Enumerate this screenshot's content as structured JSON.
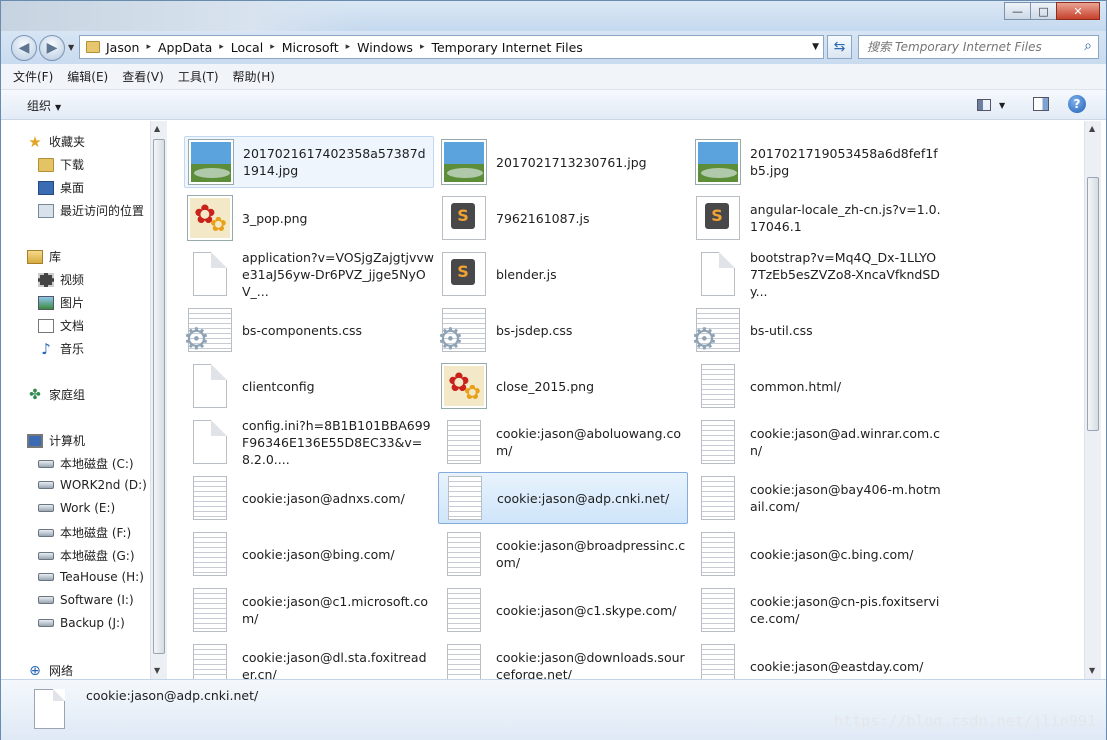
{
  "window": {
    "min_label": "—",
    "max_label": "□",
    "close_label": "✕"
  },
  "address": {
    "crumbs": [
      "Jason",
      "AppData",
      "Local",
      "Microsoft",
      "Windows",
      "Temporary Internet Files"
    ],
    "separator": "▸",
    "dropdown": "▼"
  },
  "search": {
    "placeholder": "搜索 Temporary Internet Files"
  },
  "menu": [
    "文件(F)",
    "编辑(E)",
    "查看(V)",
    "工具(T)",
    "帮助(H)"
  ],
  "toolbar": {
    "organize": "组织",
    "help": "?"
  },
  "nav": {
    "favorites": "收藏夹",
    "downloads": "下载",
    "desktop": "桌面",
    "recent": "最近访问的位置",
    "libraries": "库",
    "videos": "视频",
    "pictures": "图片",
    "documents": "文档",
    "music": "音乐",
    "homegroup": "家庭组",
    "computer": "计算机",
    "drives": [
      "本地磁盘 (C:)",
      "WORK2nd (D:)",
      "Work (E:)",
      "本地磁盘 (F:)",
      "本地磁盘 (G:)",
      "TeaHouse (H:)",
      "Software (I:)",
      "Backup (J:)"
    ],
    "network": "网络"
  },
  "files": [
    [
      "2017021617402358a57387d1914.jpg",
      "2017021713230761.jpg",
      "2017021719053458a6d8fef1fb5.jpg"
    ],
    [
      "3_pop.png",
      "7962161087.js",
      "angular-locale_zh-cn.js?v=1.0.17046.1"
    ],
    [
      "application?v=VOSjgZajgtjvvwe31aJ56yw-Dr6PVZ_jjge5NyOV_...",
      "blender.js",
      "bootstrap?v=Mq4Q_Dx-1LLYO7TzEb5esZVZo8-XncaVfkndSDy..."
    ],
    [
      "bs-components.css",
      "bs-jsdep.css",
      "bs-util.css"
    ],
    [
      "clientconfig",
      "close_2015.png",
      "common.html/"
    ],
    [
      "config.ini?h=8B1B101BBA699F96346E136E55D8EC33&v=8.2.0....",
      "cookie:jason@aboluowang.com/",
      "cookie:jason@ad.winrar.com.cn/"
    ],
    [
      "cookie:jason@adnxs.com/",
      "cookie:jason@adp.cnki.net/",
      "cookie:jason@bay406-m.hotmail.com/"
    ],
    [
      "cookie:jason@bing.com/",
      "cookie:jason@broadpressinc.com/",
      "cookie:jason@c.bing.com/"
    ],
    [
      "cookie:jason@c1.microsoft.com/",
      "cookie:jason@c1.skype.com/",
      "cookie:jason@cn-pis.foxitservice.com/"
    ],
    [
      "cookie:jason@dl.sta.foxitreader.cn/",
      "cookie:jason@downloads.sourceforge.net/",
      "cookie:jason@eastday.com/"
    ]
  ],
  "icons": [
    [
      "img",
      "img",
      "img"
    ],
    [
      "flower",
      "js",
      "js"
    ],
    [
      "blank",
      "js",
      "blank"
    ],
    [
      "css",
      "css",
      "css"
    ],
    [
      "blank",
      "flower",
      "text"
    ],
    [
      "blank",
      "text",
      "text"
    ],
    [
      "text",
      "text",
      "text"
    ],
    [
      "text",
      "text",
      "text"
    ],
    [
      "text",
      "text",
      "text"
    ],
    [
      "text",
      "text",
      "text"
    ]
  ],
  "selected_file": "cookie:jason@adp.cnki.net/",
  "details": {
    "name": "cookie:jason@adp.cnki.net/"
  },
  "watermark": "https://blog.csdn.net/jlin991"
}
